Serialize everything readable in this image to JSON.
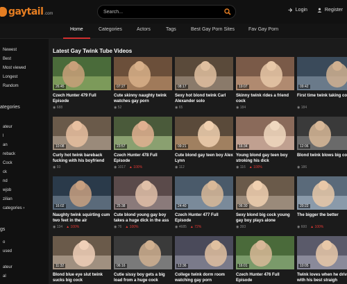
{
  "brand": {
    "name": "gaytail",
    "tld": ".com",
    "accent": "#e67e22"
  },
  "search": {
    "placeholder": "Search..."
  },
  "top_links": {
    "login": "Login",
    "register": "Register"
  },
  "nav": [
    {
      "label": "Home",
      "active": true
    },
    {
      "label": "Categories"
    },
    {
      "label": "Actors"
    },
    {
      "label": "Tags"
    },
    {
      "label": "Best Gay Porn Sites"
    },
    {
      "label": "Fav Gay Porn"
    }
  ],
  "sidebar": {
    "sort": [
      "Newest",
      "Best",
      "Most viewed",
      "Longest",
      "Random"
    ],
    "categories_heading": "ategories",
    "categories": [
      "ateur",
      "l",
      "an",
      "reback",
      "Cock",
      "ck",
      "nd",
      "wjob",
      "zilian",
      "categories"
    ],
    "tags_heading": "gs",
    "tags": [
      "o",
      "used",
      "ateur",
      "al"
    ]
  },
  "main": {
    "title": "Latest Gay Twink Tube Videos",
    "videos": [
      {
        "duration": "26:45",
        "title": "Czech Hunter 479 Full Episode",
        "views": "688",
        "rating": ""
      },
      {
        "duration": "07:27",
        "title": "Cute skinny naughty twink watches gay porn",
        "views": "52",
        "rating": ""
      },
      {
        "duration": "08:17",
        "title": "Sexy hot blond twink Carl Alexander solo",
        "views": "65",
        "rating": ""
      },
      {
        "duration": "19:07",
        "title": "Skinny twink rides a friend cock",
        "views": "184",
        "rating": ""
      },
      {
        "duration": "09:42",
        "title": "First time twink taking co",
        "views": "184",
        "rating": ""
      },
      {
        "duration": "10:08",
        "title": "Curly hot twink bareback fucking with his boyfriend",
        "views": "93",
        "rating": ""
      },
      {
        "duration": "23:57",
        "title": "Czech Hunter 478 Full Episode",
        "views": "1017",
        "rating": "100%"
      },
      {
        "duration": "09:21",
        "title": "Cute blond gay teen boy Alex Lynn",
        "views": "112",
        "rating": ""
      },
      {
        "duration": "16:34",
        "title": "Young blond gay teen boy stroking his dick",
        "views": "116",
        "rating": "100%"
      },
      {
        "duration": "12:06",
        "title": "Blond twink blows big co",
        "views": "186",
        "rating": ""
      },
      {
        "duration": "16:02",
        "title": "Naughty twink squirting cum two feet in the air",
        "views": "134",
        "rating": "100%"
      },
      {
        "duration": "25:38",
        "title": "Cute blond young gay boy takes a huge dick in the ass",
        "views": "76",
        "rating": "100%"
      },
      {
        "duration": "24:40",
        "title": "Czech Hunter 477 Full Episode",
        "views": "4685",
        "rating": "72%"
      },
      {
        "duration": "06:30",
        "title": "Sexy blond big cock young gay boy plays alone",
        "views": "393",
        "rating": ""
      },
      {
        "duration": "20:22",
        "title": "The bigger the better",
        "views": "600",
        "rating": "100%"
      },
      {
        "duration": "11:32",
        "title": "Blond blue eye slut twink sucks big cock",
        "views": "",
        "rating": ""
      },
      {
        "duration": "06:16",
        "title": "Cutie sissy boy gets a big load from a huge cock",
        "views": "",
        "rating": ""
      },
      {
        "duration": "12:36",
        "title": "College twink dorm room watching gay porn",
        "views": "",
        "rating": ""
      },
      {
        "duration": "16:01",
        "title": "Czech Hunter 476 Full Episode",
        "views": "",
        "rating": ""
      },
      {
        "duration": "10:05",
        "title": "Twink loves when he driv out with his best straigh",
        "views": "",
        "rating": ""
      }
    ]
  },
  "colors": {
    "background": "#1b1b1b",
    "topbar": "#111111",
    "nav_underline": "#d32f2f",
    "rating": "#e53935",
    "search_icon": "#e67e22"
  }
}
